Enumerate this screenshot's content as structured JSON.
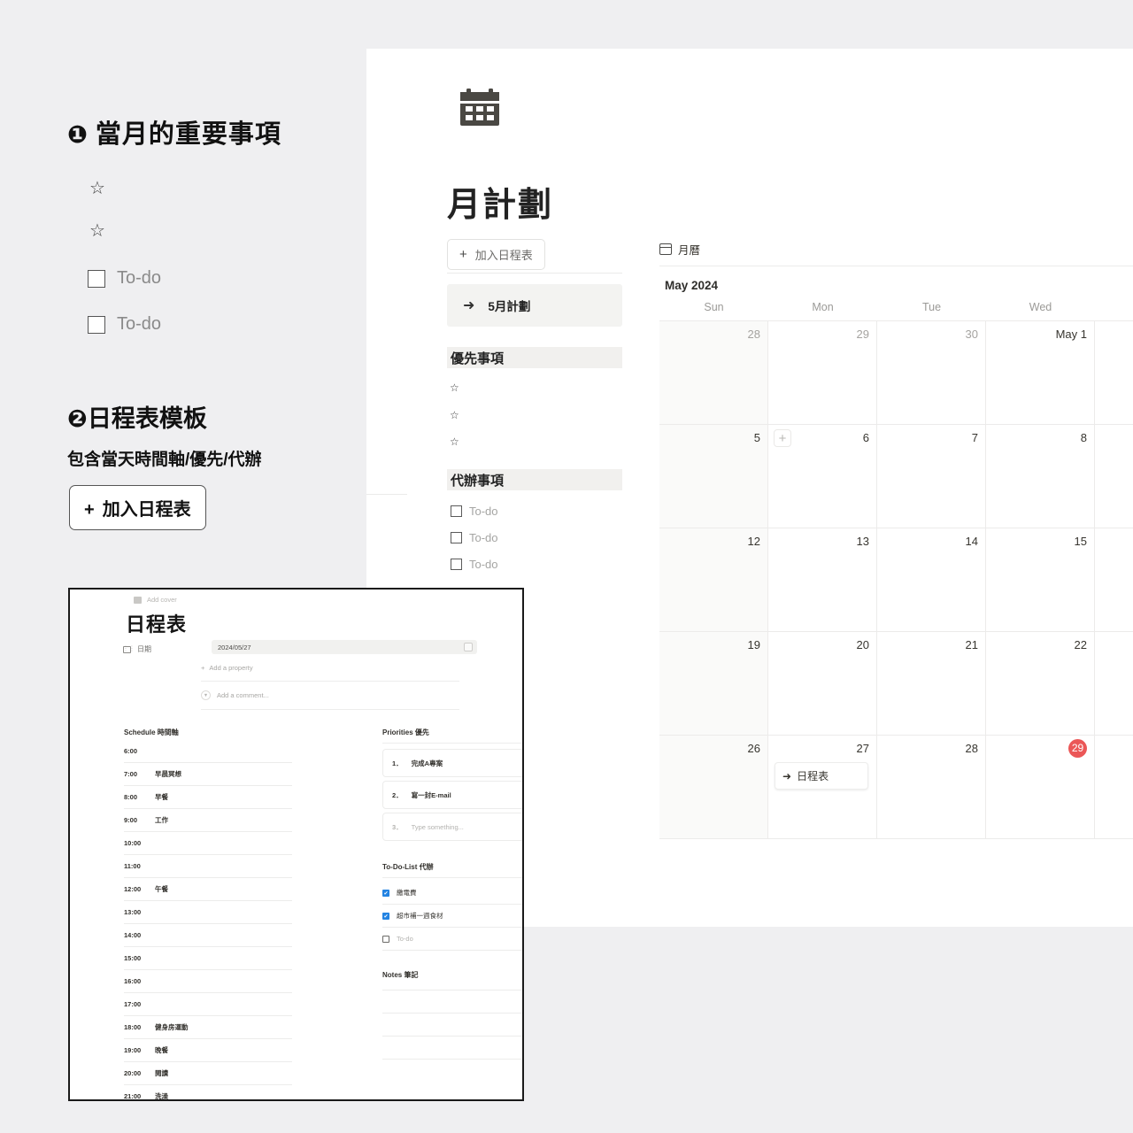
{
  "promo": {
    "section1": {
      "number": "❶",
      "title": "當月的重要事項",
      "star_icon": "☆",
      "items": [
        {
          "type": "star",
          "label": ""
        },
        {
          "type": "star",
          "label": ""
        },
        {
          "type": "todo",
          "label": "To-do"
        },
        {
          "type": "todo",
          "label": "To-do"
        }
      ]
    },
    "section2": {
      "number": "❷",
      "title": "日程表模板",
      "subtitle": "包含當天時間軸/優先/代辦",
      "button_plus": "+",
      "button_label": "加入日程表"
    }
  },
  "notion": {
    "page_icon": "calendar-emoji",
    "page_title": "月計劃",
    "add_schedule": {
      "plus": "+",
      "label": "加入日程表"
    },
    "link_card": {
      "arrow": "➜",
      "label": "5月計劃"
    },
    "priority_section": {
      "heading": "優先事項",
      "star_icon": "☆",
      "items": [
        "",
        "",
        ""
      ]
    },
    "todo_section": {
      "heading": "代辦事項",
      "items": [
        "To-do",
        "To-do",
        "To-do"
      ]
    }
  },
  "calendar": {
    "tab_label": "月曆",
    "month_label": "May 2024",
    "day_names": [
      "Sun",
      "Mon",
      "Tue",
      "Wed"
    ],
    "today": "29",
    "today_color": "#eb5757",
    "plus_icon": "+",
    "weeks": [
      [
        {
          "day": "28",
          "muted": true
        },
        {
          "day": "29",
          "muted": true
        },
        {
          "day": "30",
          "muted": true
        },
        {
          "day": "May 1",
          "muted": false
        }
      ],
      [
        {
          "day": "5",
          "muted": false
        },
        {
          "day": "6",
          "muted": false,
          "has_plus": true
        },
        {
          "day": "7",
          "muted": false
        },
        {
          "day": "8",
          "muted": false
        }
      ],
      [
        {
          "day": "12",
          "muted": false
        },
        {
          "day": "13",
          "muted": false
        },
        {
          "day": "14",
          "muted": false
        },
        {
          "day": "15",
          "muted": false
        }
      ],
      [
        {
          "day": "19",
          "muted": false
        },
        {
          "day": "20",
          "muted": false
        },
        {
          "day": "21",
          "muted": false
        },
        {
          "day": "22",
          "muted": false
        }
      ],
      [
        {
          "day": "26",
          "muted": false
        },
        {
          "day": "27",
          "muted": false,
          "event": {
            "arrow": "➜",
            "label": "日程表"
          }
        },
        {
          "day": "28",
          "muted": false
        },
        {
          "day": "29",
          "muted": false,
          "is_today": true
        }
      ]
    ]
  },
  "popup": {
    "add_cover": "Add cover",
    "title": "日程表",
    "property_name": "日期",
    "date_value": "2024/05/27",
    "add_property": "Add a property",
    "add_property_plus": "+",
    "comment_placeholder": "Add a comment...",
    "schedule": {
      "heading": "Schedule 時間軸",
      "rows": [
        {
          "time": "6:00",
          "event": ""
        },
        {
          "time": "7:00",
          "event": "早晨冥想"
        },
        {
          "time": "8:00",
          "event": "早餐"
        },
        {
          "time": "9:00",
          "event": "工作"
        },
        {
          "time": "10:00",
          "event": ""
        },
        {
          "time": "11:00",
          "event": ""
        },
        {
          "time": "12:00",
          "event": "午餐"
        },
        {
          "time": "13:00",
          "event": ""
        },
        {
          "time": "14:00",
          "event": ""
        },
        {
          "time": "15:00",
          "event": ""
        },
        {
          "time": "16:00",
          "event": ""
        },
        {
          "time": "17:00",
          "event": ""
        },
        {
          "time": "18:00",
          "event": "健身房運動"
        },
        {
          "time": "19:00",
          "event": "晚餐"
        },
        {
          "time": "20:00",
          "event": "閱讀"
        },
        {
          "time": "21:00",
          "event": "洗澡"
        }
      ]
    },
    "priorities": {
      "heading": "Priorities 優先",
      "items": [
        {
          "index": "1．",
          "text": "完成A專案",
          "placeholder": ""
        },
        {
          "index": "2．",
          "text": "寫一封E-mail",
          "placeholder": ""
        },
        {
          "index": "3．",
          "text": "",
          "placeholder": "Type something..."
        }
      ]
    },
    "todolist": {
      "heading": "To-Do-List 代辦",
      "items": [
        {
          "label": "繳電費",
          "checked": true
        },
        {
          "label": "超市補一週食材",
          "checked": true
        },
        {
          "label": "To-do",
          "checked": false
        }
      ]
    },
    "notes": {
      "heading": "Notes 筆記",
      "line_count": 4
    }
  }
}
